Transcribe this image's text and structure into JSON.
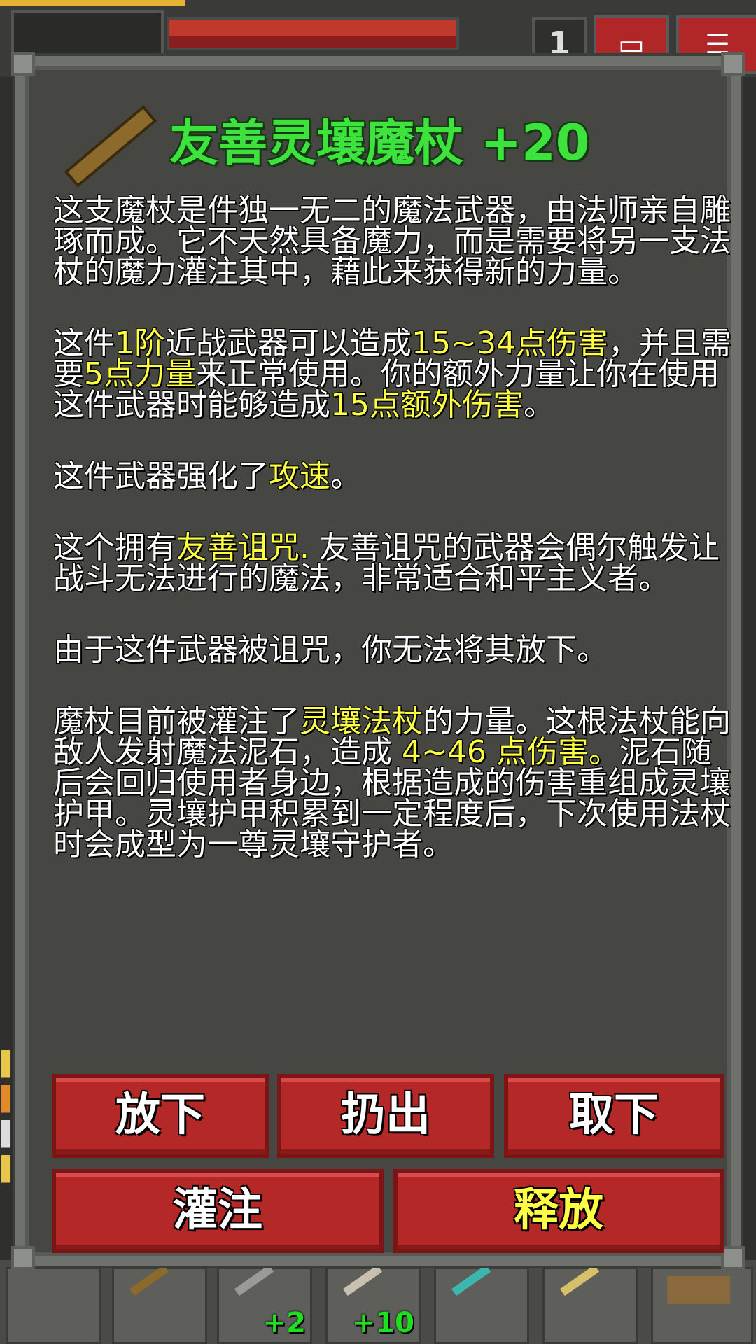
{
  "hud": {
    "depth": "1",
    "journal_icon": "journal-icon",
    "menu_icon": "menu-icon"
  },
  "inventory": {
    "slots": [
      {
        "bonus": ""
      },
      {
        "bonus": ""
      },
      {
        "bonus": "+2"
      },
      {
        "bonus": "+10"
      },
      {
        "bonus": ""
      },
      {
        "bonus": ""
      },
      {
        "bonus": ""
      }
    ]
  },
  "item": {
    "icon": "wand-icon",
    "title": "友善灵壤魔杖 +20",
    "paragraphs": {
      "p1": "这支魔杖是件独一无二的魔法武器，由法师亲自雕琢而成。它不天然具备魔力，而是需要将另一支法杖的魔力灌注其中，藉此来获得新的力量。",
      "p2": {
        "a": "这件",
        "b": "1阶",
        "c": "近战武器可以造成",
        "d": "15~34点伤害",
        "e": "，并且需要",
        "f": "5点力量",
        "g": "来正常使用。你的额外力量让你在使用这件武器时能够造成",
        "h": "15点额外伤害",
        "i": "。"
      },
      "p3": {
        "a": "这件武器强化了",
        "b": "攻速",
        "c": "。"
      },
      "p4": {
        "a": "这个拥有",
        "b": "友善诅咒.",
        "c": " 友善诅咒的武器会偶尔触发让战斗无法进行的魔法，非常适合和平主义者。"
      },
      "p5": "由于这件武器被诅咒，你无法将其放下。",
      "p6": {
        "a": "魔杖目前被灌注了",
        "b": "灵壤法杖",
        "c": "的力量。这根法杖能向敌人发射魔法泥石，造成 ",
        "d": "4~46 点伤害。",
        "e": "泥石随后会回归使用者身边，根据造成的伤害重组成灵壤护甲。灵壤护甲积累到一定程度后，下次使用法杖时会成型为一尊灵壤守护者。"
      }
    }
  },
  "buttons": {
    "drop": "放下",
    "throw": "扔出",
    "unequip": "取下",
    "imbue": "灌注",
    "release": "释放"
  },
  "colors": {
    "title": "#3de23d",
    "highlight": "#ffff44",
    "button": "#b52828",
    "window_bg": "#464642"
  }
}
